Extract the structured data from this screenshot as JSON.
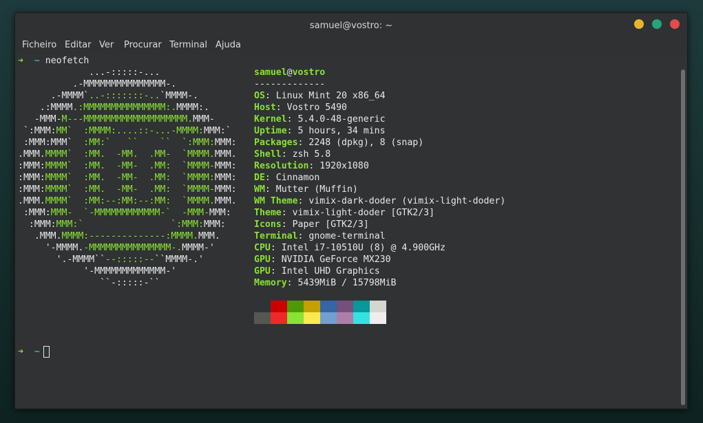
{
  "window": {
    "title": "samuel@vostro: ~"
  },
  "menu": [
    "Ficheiro",
    "Editar",
    "Ver",
    "Procurar",
    "Terminal",
    "Ajuda"
  ],
  "terminal": {
    "prompt_arrow": "➜",
    "prompt_dir": "~",
    "command": "neofetch",
    "logo": [
      [
        [
          "w",
          "             ...-:::::-..."
        ]
      ],
      [
        [
          "w",
          "          .-MMMMMMMMMMMMMMM-."
        ]
      ],
      [
        [
          "w",
          "      .-MMMM`"
        ],
        [
          "g",
          "..-:::::::-.."
        ],
        [
          "w",
          "`MMMM-."
        ]
      ],
      [
        [
          "w",
          "    .:MMMM"
        ],
        [
          "g",
          ".:MMMMMMMMMMMMMMM:."
        ],
        [
          "w",
          "MMMM:."
        ]
      ],
      [
        [
          "w",
          "   -MMM-"
        ],
        [
          "g",
          "M---MMMMMMMMMMMMMMMMMMM."
        ],
        [
          "w",
          "MMM-"
        ]
      ],
      [
        [
          "w",
          " `:MMM:"
        ],
        [
          "g",
          "MM`  :MMMM:....::-...-MMMM:"
        ],
        [
          "w",
          "MMM:`"
        ]
      ],
      [
        [
          "w",
          " :MMM:MMM`"
        ],
        [
          "g",
          "  :MM:`   ``    ``  `:MMM:"
        ],
        [
          "w",
          "MMM:"
        ]
      ],
      [
        [
          "w",
          ".MMM."
        ],
        [
          "g",
          "MMMM`  :MM.  -MM.  .MM-  `MMMM."
        ],
        [
          "w",
          "MMM."
        ]
      ],
      [
        [
          "w",
          ":MMM:"
        ],
        [
          "g",
          "MMMM`  :MM.  -MM-  .MM:  `MMMM-"
        ],
        [
          "w",
          "MMM:"
        ]
      ],
      [
        [
          "w",
          ":MMM:"
        ],
        [
          "g",
          "MMMM`  :MM.  -MM-  .MM:  `MMMM:"
        ],
        [
          "w",
          "MMM:"
        ]
      ],
      [
        [
          "w",
          ":MMM:"
        ],
        [
          "g",
          "MMMM`  :MM.  -MM-  .MM:  `MMMM-"
        ],
        [
          "w",
          "MMM:"
        ]
      ],
      [
        [
          "w",
          ".MMM."
        ],
        [
          "g",
          "MMMM`  :MM:--:MM:--:MM:  `MMMM."
        ],
        [
          "w",
          "MMM."
        ]
      ],
      [
        [
          "w",
          " :MMM:"
        ],
        [
          "g",
          "MMM-  `-MMMMMMMMMMMM-`  -MMM-"
        ],
        [
          "w",
          "MMM:"
        ]
      ],
      [
        [
          "w",
          "  :MMM:"
        ],
        [
          "g",
          "MMM:`                `:MMM:"
        ],
        [
          "w",
          "MMM:"
        ]
      ],
      [
        [
          "w",
          "   .MMM."
        ],
        [
          "g",
          "MMMM:--------------:MMMM."
        ],
        [
          "w",
          "MMM."
        ]
      ],
      [
        [
          "w",
          "     '-MMMM."
        ],
        [
          "g",
          "-MMMMMMMMMMMMMMM-."
        ],
        [
          "w",
          "MMMM-'"
        ]
      ],
      [
        [
          "w",
          "       '.-MMMM``"
        ],
        [
          "g",
          "--:::::--"
        ],
        [
          "w",
          "``MMMM-.'"
        ]
      ],
      [
        [
          "w",
          "            '-MMMMMMMMMMMMM-'"
        ]
      ],
      [
        [
          "w",
          "               ``-:::::-``"
        ]
      ]
    ],
    "info_user": "samuel",
    "info_at": "@",
    "info_host": "vostro",
    "info_separator": "-------------",
    "info": [
      {
        "key": "OS",
        "value": "Linux Mint 20 x86_64"
      },
      {
        "key": "Host",
        "value": "Vostro 5490"
      },
      {
        "key": "Kernel",
        "value": "5.4.0-48-generic"
      },
      {
        "key": "Uptime",
        "value": "5 hours, 34 mins"
      },
      {
        "key": "Packages",
        "value": "2248 (dpkg), 8 (snap)"
      },
      {
        "key": "Shell",
        "value": "zsh 5.8"
      },
      {
        "key": "Resolution",
        "value": "1920x1080"
      },
      {
        "key": "DE",
        "value": "Cinnamon"
      },
      {
        "key": "WM",
        "value": "Mutter (Muffin)"
      },
      {
        "key": "WM Theme",
        "value": "vimix-dark-doder (vimix-light-doder)"
      },
      {
        "key": "Theme",
        "value": "vimix-light-doder [GTK2/3]"
      },
      {
        "key": "Icons",
        "value": "Paper [GTK2/3]"
      },
      {
        "key": "Terminal",
        "value": "gnome-terminal"
      },
      {
        "key": "CPU",
        "value": "Intel i7-10510U (8) @ 4.900GHz"
      },
      {
        "key": "GPU",
        "value": "NVIDIA GeForce MX230"
      },
      {
        "key": "GPU",
        "value": "Intel UHD Graphics"
      },
      {
        "key": "Memory",
        "value": "5439MiB / 15798MiB"
      }
    ],
    "palette_row1": [
      "#2e3436",
      "#cc0000",
      "#4e9a06",
      "#c4a000",
      "#3465a4",
      "#75507b",
      "#06989a",
      "#d3d7cf"
    ],
    "palette_row2": [
      "#555753",
      "#ef2929",
      "#8ae234",
      "#fce94f",
      "#729fcf",
      "#ad7fa8",
      "#34e2e2",
      "#eeeeec"
    ]
  }
}
